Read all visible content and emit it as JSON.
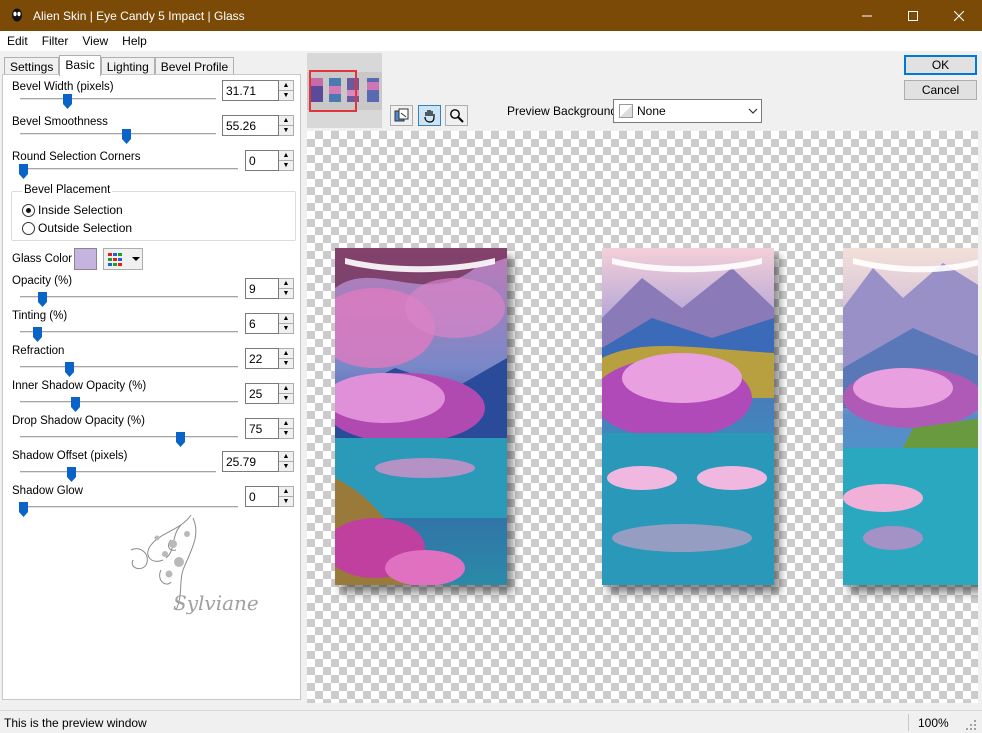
{
  "window": {
    "title": "Alien Skin | Eye Candy 5 Impact | Glass"
  },
  "menu": [
    "Edit",
    "Filter",
    "View",
    "Help"
  ],
  "tabs": [
    "Settings",
    "Basic",
    "Lighting",
    "Bevel Profile"
  ],
  "active_tab": "Basic",
  "basic": {
    "bevel_width": {
      "label": "Bevel Width (pixels)",
      "value": "31.71",
      "slider": 0.25
    },
    "bevel_smoothness": {
      "label": "Bevel Smoothness",
      "value": "55.26",
      "slider": 0.55
    },
    "round_corners": {
      "label": "Round Selection Corners",
      "value": "0",
      "slider": 0.0
    },
    "bevel_placement": {
      "label": "Bevel Placement",
      "inside": "Inside Selection",
      "outside": "Outside Selection",
      "selected": "inside"
    },
    "glass_color": {
      "label": "Glass Color",
      "color": "#c6b4e0"
    },
    "opacity": {
      "label": "Opacity (%)",
      "value": "9",
      "slider": 0.09
    },
    "tinting": {
      "label": "Tinting (%)",
      "value": "6",
      "slider": 0.06
    },
    "refraction": {
      "label": "Refraction",
      "value": "22",
      "slider": 0.22
    },
    "inner_shadow": {
      "label": "Inner Shadow Opacity (%)",
      "value": "25",
      "slider": 0.25
    },
    "drop_shadow": {
      "label": "Drop Shadow Opacity (%)",
      "value": "75",
      "slider": 0.75
    },
    "shadow_offset": {
      "label": "Shadow Offset (pixels)",
      "value": "25.79",
      "slider": 0.26
    },
    "shadow_glow": {
      "label": "Shadow Glow",
      "value": "0",
      "slider": 0.0
    }
  },
  "watermark": "Sylviane",
  "preview_background": {
    "label": "Preview Background:",
    "value": "None"
  },
  "buttons": {
    "ok": "OK",
    "cancel": "Cancel"
  },
  "status": {
    "message": "This is the preview window",
    "zoom": "100%"
  },
  "colors": {
    "titlebar": "#7a4a06",
    "slider_thumb": "#0a64c8",
    "accent": "#0078d7"
  }
}
